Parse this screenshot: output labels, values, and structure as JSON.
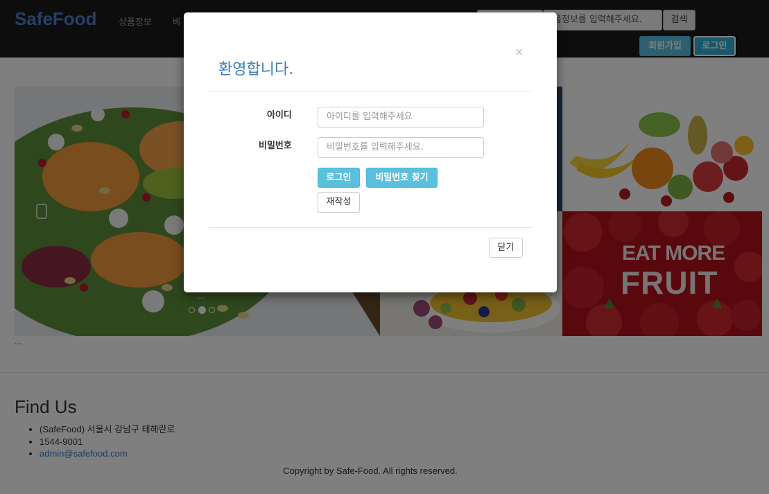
{
  "navbar": {
    "brand": "SafeFood",
    "items": [
      "상품정보",
      "베"
    ],
    "search_placeholder": "상품정보를 입력해주세요.",
    "search_button": "검색",
    "signup_button": "회원가입",
    "login_button": "로그인"
  },
  "carousel": {
    "overlay_text": "...",
    "indicator_count": 3,
    "active_indicator": 2
  },
  "content": {
    "strawberry_line1": "EAT MORE",
    "strawberry_line2": "FRUIT",
    "ellipsis": "..."
  },
  "footer": {
    "title": "Find Us",
    "address": "(SafeFood) 서울시 강남구 테헤란로",
    "phone": "1544-9001",
    "email": "admin@safefood.com",
    "copyright": "Copyright by Safe-Food. All rights reserved."
  },
  "modal": {
    "title": "환영합니다.",
    "close_symbol": "×",
    "id_label": "아이디",
    "id_placeholder": "아이디를 입력해주세요",
    "pw_label": "비밀번호",
    "pw_placeholder": "비밀번호를 입력해주세요.",
    "login_button": "로그인",
    "find_pw_button": "비밀번호 찾기",
    "reset_button": "재작성",
    "close_button": "닫기"
  },
  "colors": {
    "brand": "#4f7fd1",
    "info": "#5bc0de",
    "modal_title": "#3b7dbd",
    "navbar_bg": "#1b1b1b"
  }
}
